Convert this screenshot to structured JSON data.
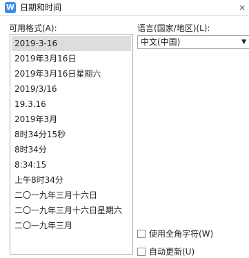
{
  "window": {
    "title": "日期和时间",
    "app_icon": "wps-writer-icon",
    "app_icon_glyph": "W",
    "close_glyph": "×"
  },
  "formats": {
    "label": "可用格式(A):",
    "selected_index": 0,
    "items": [
      "2019-3-16",
      "2019年3月16日",
      "2019年3月16日星期六",
      "2019/3/16",
      "19.3.16",
      "2019年3月",
      "8时34分15秒",
      "8时34分",
      "8:34:15",
      "上午8时34分",
      "二〇一九年三月十六日",
      "二〇一九年三月十六日星期六",
      "二〇一九年三月"
    ]
  },
  "language": {
    "label": "语言(国家/地区)(L):",
    "value": "中文(中国)"
  },
  "options": {
    "fullwidth_label": "使用全角字符(W)",
    "fullwidth_checked": false,
    "autoupdate_label": "自动更新(U)",
    "autoupdate_checked": false
  },
  "colors": {
    "accent": "#3a8de8",
    "selection": "#dddddd",
    "border": "#a9a9a9"
  }
}
